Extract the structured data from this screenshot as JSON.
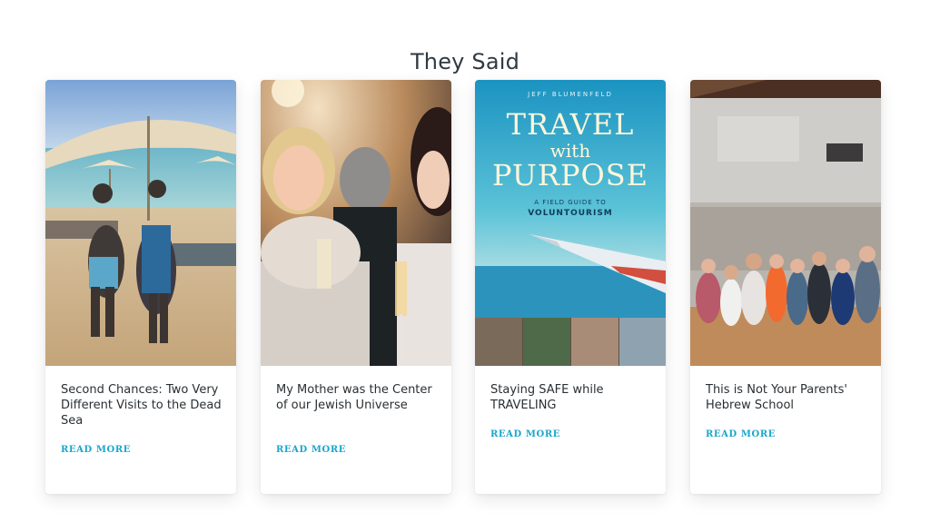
{
  "section": {
    "title": "They Said"
  },
  "cards": [
    {
      "title": "Second Chances: Two Very Different Visits to the Dead Sea",
      "read_more": "READ MORE",
      "image": "dead-sea-photo"
    },
    {
      "title": "My Mother was the Center of our Jewish Universe",
      "read_more": "READ MORE",
      "image": "celebration-photo"
    },
    {
      "title": "Staying SAFE while TRAVELING",
      "read_more": "READ MORE",
      "image": "book-cover",
      "book": {
        "author": "JEFF BLUMENFELD",
        "line1": "TRAVEL",
        "line2": "with",
        "line3": "PURPOSE",
        "subtitle": "A FIELD GUIDE TO",
        "subtitle2": "VOLUNTOURISM"
      }
    },
    {
      "title": "This is Not Your Parents' Hebrew School",
      "read_more": "READ MORE",
      "image": "group-photo"
    }
  ],
  "colors": {
    "accent": "#1aa6cc",
    "heading": "#2f3a42",
    "text": "#2a2f33"
  }
}
